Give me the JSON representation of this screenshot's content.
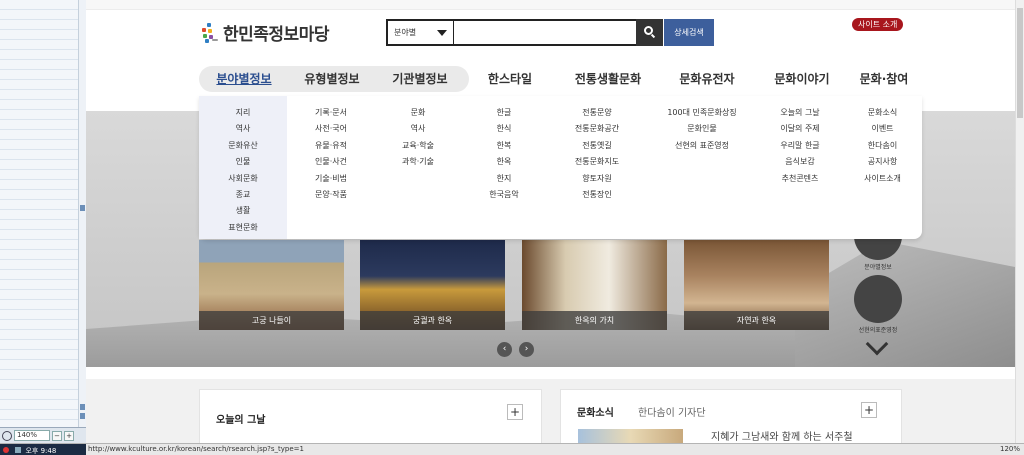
{
  "header": {
    "logo_text": "한민족정보마당",
    "search_select": "분야별",
    "advanced_search": "상세검색",
    "site_intro": "사이트 소개"
  },
  "gnb": [
    "분야별정보",
    "유형별정보",
    "기관별정보",
    "한스타일",
    "전통생활문화",
    "문화유전자",
    "문화이야기",
    "문화·참여"
  ],
  "mega_menu": [
    [
      "지리",
      "역사",
      "문화유산",
      "인물",
      "사회문화",
      "종교",
      "생활",
      "표현문화"
    ],
    [
      "기록·문서",
      "사전·국어",
      "유물·유적",
      "인물·사건",
      "기술·비법",
      "문양·작품"
    ],
    [
      "문화",
      "역사",
      "교육·학술",
      "과학·기술"
    ],
    [
      "한글",
      "한식",
      "한복",
      "한옥",
      "한지",
      "한국음악"
    ],
    [
      "전통문양",
      "전통문화공간",
      "전통옛길",
      "전통문화지도",
      "향토자원",
      "전통장인"
    ],
    [
      "100대 민족문화상징",
      "문화인물",
      "선현의 표준영정"
    ],
    [
      "오늘의 그날",
      "이달의 주제",
      "우리말 한글",
      "음식보감",
      "추천콘텐츠"
    ],
    [
      "문화소식",
      "이벤트",
      "한다솜이",
      "공지사항",
      "사이트소개"
    ]
  ],
  "carousel": {
    "cards": [
      "고궁 나들이",
      "궁궐과 한옥",
      "한옥의 가치",
      "자연과 한옥"
    ],
    "prev": "‹",
    "next": "›"
  },
  "quick_links": [
    "분야별정보",
    "선현의표준영정"
  ],
  "panels": {
    "today": {
      "title": "오늘의 그날",
      "plus": "+"
    },
    "news": {
      "title": "문화소식",
      "tab": "한다솜이 기자단",
      "plus": "+",
      "headline": "지혜가 그남새와 함께 하는 서주철"
    }
  },
  "statusbar": {
    "time": "오후 9:48",
    "url": "http://www.kculture.or.kr/korean/search/rsearch.jsp?s_type=1",
    "zoom": "120%",
    "left_zoom": "140%"
  },
  "colors": {
    "accent_blue": "#3d5f9c",
    "site_intro_red": "#a8161d",
    "active_menu": "#2b4e8f"
  }
}
